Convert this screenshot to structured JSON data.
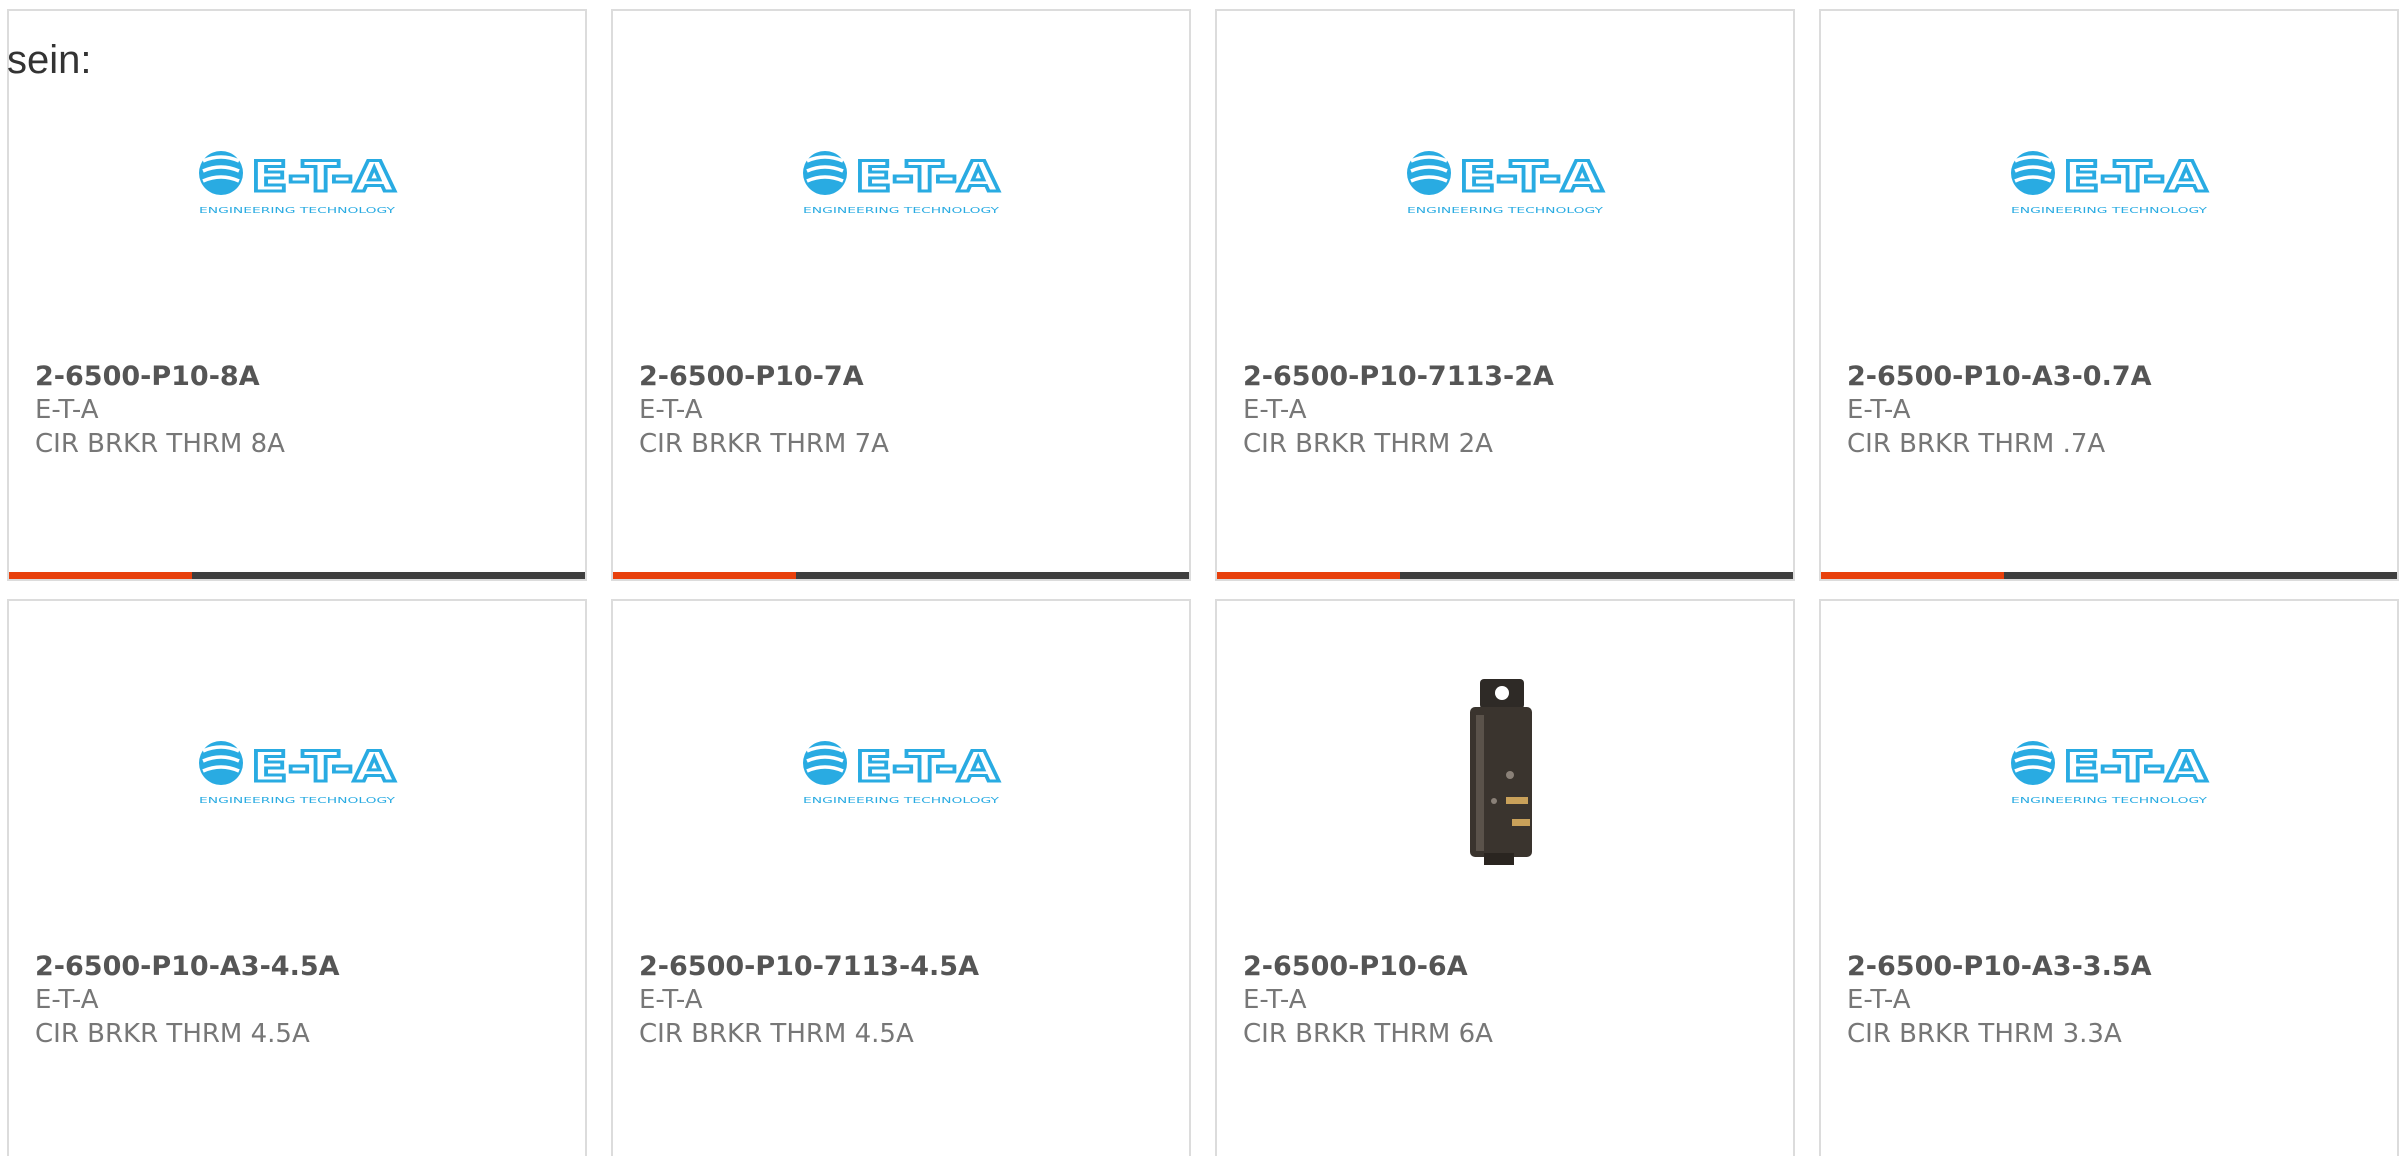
{
  "intro": {
    "text": "sein:"
  },
  "brand": {
    "accent": "#e8400c",
    "bar": "#3e3e3e",
    "logo_blue": "#29abe2"
  },
  "logo": {
    "wordmark": "E-T-A",
    "tagline": "ENGINEERING TECHNOLOGY"
  },
  "products": [
    {
      "part": "2-6500-P10-8A",
      "manufacturer": "E-T-A",
      "description": "CIR BRKR THRM 8A",
      "image": "eta-logo-icon"
    },
    {
      "part": "2-6500-P10-7A",
      "manufacturer": "E-T-A",
      "description": "CIR BRKR THRM 7A",
      "image": "eta-logo-icon"
    },
    {
      "part": "2-6500-P10-7113-2A",
      "manufacturer": "E-T-A",
      "description": "CIR BRKR THRM 2A",
      "image": "eta-logo-icon"
    },
    {
      "part": "2-6500-P10-A3-0.7A",
      "manufacturer": "E-T-A",
      "description": "CIR BRKR THRM .7A",
      "image": "eta-logo-icon"
    },
    {
      "part": "2-6500-P10-A3-4.5A",
      "manufacturer": "E-T-A",
      "description": "CIR BRKR THRM 4.5A",
      "image": "eta-logo-icon"
    },
    {
      "part": "2-6500-P10-7113-4.5A",
      "manufacturer": "E-T-A",
      "description": "CIR BRKR THRM 4.5A",
      "image": "eta-logo-icon"
    },
    {
      "part": "2-6500-P10-6A",
      "manufacturer": "E-T-A",
      "description": "CIR BRKR THRM 6A",
      "image": "circuit-breaker-photo-icon"
    },
    {
      "part": "2-6500-P10-A3-3.5A",
      "manufacturer": "E-T-A",
      "description": "CIR BRKR THRM 3.3A",
      "image": "eta-logo-icon"
    }
  ]
}
